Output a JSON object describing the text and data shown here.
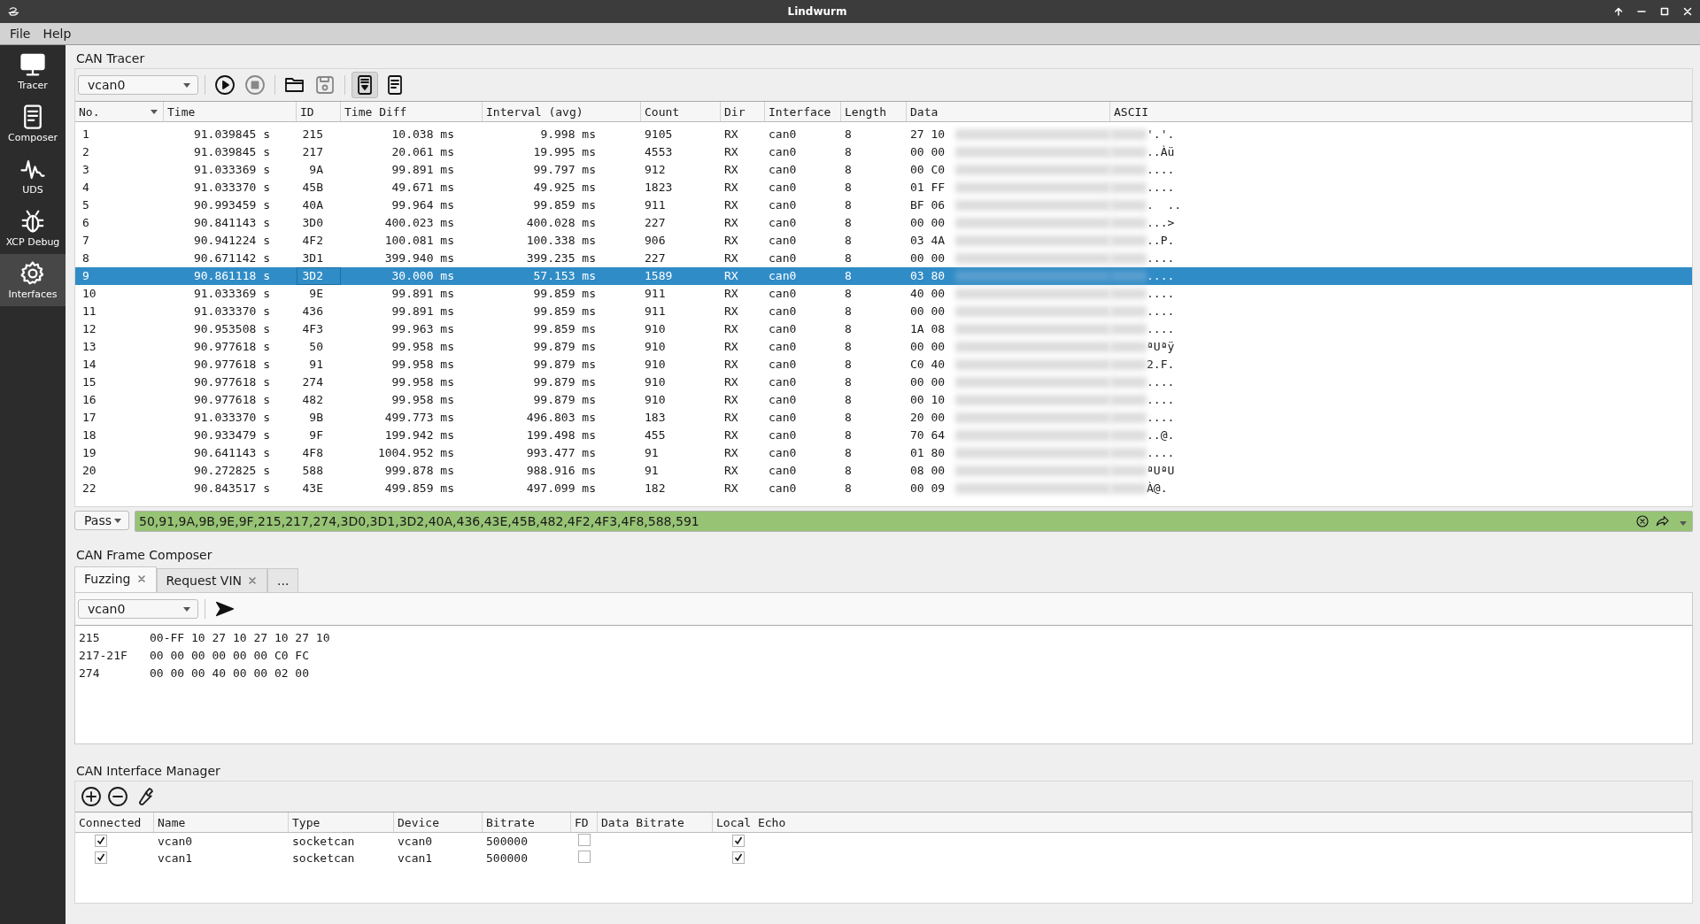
{
  "window": {
    "title": "Lindwurm"
  },
  "menu": [
    "File",
    "Help"
  ],
  "sidebar": {
    "items": [
      {
        "label": "Tracer",
        "kind": "monitor",
        "selected": false
      },
      {
        "label": "Composer",
        "kind": "document",
        "selected": false
      },
      {
        "label": "UDS",
        "kind": "wave",
        "selected": false
      },
      {
        "label": "XCP Debug",
        "kind": "bug",
        "selected": false
      },
      {
        "label": "Interfaces",
        "kind": "gear",
        "selected": true
      }
    ]
  },
  "tracer": {
    "title": "CAN Tracer",
    "interface": "vcan0",
    "toolbar": [
      {
        "kind": "play",
        "disabled": false,
        "pressed": false
      },
      {
        "kind": "stop",
        "disabled": true,
        "pressed": false
      },
      {
        "kind": "open",
        "disabled": false,
        "pressed": false
      },
      {
        "kind": "save",
        "disabled": true,
        "pressed": false
      },
      {
        "kind": "autoscroll",
        "disabled": false,
        "pressed": true
      },
      {
        "kind": "log",
        "disabled": false,
        "pressed": false
      }
    ],
    "columns": [
      {
        "label": "No.",
        "sorted": true
      },
      {
        "label": "Time",
        "sorted": false
      },
      {
        "label": "ID",
        "sorted": false
      },
      {
        "label": "Time Diff",
        "sorted": false
      },
      {
        "label": "Interval (avg)",
        "sorted": false
      },
      {
        "label": "Count",
        "sorted": false
      },
      {
        "label": "Dir",
        "sorted": false
      },
      {
        "label": "Interface",
        "sorted": false
      },
      {
        "label": "Length",
        "sorted": false
      },
      {
        "label": "Data",
        "sorted": false
      },
      {
        "label": "ASCII",
        "sorted": false
      }
    ],
    "rows": [
      {
        "selected": false,
        "cells": [
          "1",
          "91.039845 s",
          "215",
          "10.038 ms",
          "9.998 ms",
          "9105",
          "RX",
          "can0",
          "8",
          "27 10",
          "'.'."
        ]
      },
      {
        "selected": false,
        "cells": [
          "2",
          "91.039845 s",
          "217",
          "20.061 ms",
          "19.995 ms",
          "4553",
          "RX",
          "can0",
          "8",
          "00 00",
          "..Àü"
        ]
      },
      {
        "selected": false,
        "cells": [
          "3",
          "91.033369 s",
          "9A",
          "99.891 ms",
          "99.797 ms",
          "912",
          "RX",
          "can0",
          "8",
          "00 C0",
          "...."
        ]
      },
      {
        "selected": false,
        "cells": [
          "4",
          "91.033370 s",
          "45B",
          "49.671 ms",
          "49.925 ms",
          "1823",
          "RX",
          "can0",
          "8",
          "01 FF",
          "...."
        ]
      },
      {
        "selected": false,
        "cells": [
          "5",
          "90.993459 s",
          "40A",
          "99.964 ms",
          "99.859 ms",
          "911",
          "RX",
          "can0",
          "8",
          "BF 06",
          ".  .."
        ]
      },
      {
        "selected": false,
        "cells": [
          "6",
          "90.841143 s",
          "3D0",
          "400.023 ms",
          "400.028 ms",
          "227",
          "RX",
          "can0",
          "8",
          "00 00",
          "...>"
        ]
      },
      {
        "selected": false,
        "cells": [
          "7",
          "90.941224 s",
          "4F2",
          "100.081 ms",
          "100.338 ms",
          "906",
          "RX",
          "can0",
          "8",
          "03 4A",
          "..P."
        ]
      },
      {
        "selected": false,
        "cells": [
          "8",
          "90.671142 s",
          "3D1",
          "399.940 ms",
          "399.235 ms",
          "227",
          "RX",
          "can0",
          "8",
          "00 00",
          "...."
        ]
      },
      {
        "selected": true,
        "cells": [
          "9",
          "90.861118 s",
          "3D2",
          "30.000 ms",
          "57.153 ms",
          "1589",
          "RX",
          "can0",
          "8",
          "03 80",
          "...."
        ]
      },
      {
        "selected": false,
        "cells": [
          "10",
          "91.033369 s",
          "9E",
          "99.891 ms",
          "99.859 ms",
          "911",
          "RX",
          "can0",
          "8",
          "40 00",
          "...."
        ]
      },
      {
        "selected": false,
        "cells": [
          "11",
          "91.033370 s",
          "436",
          "99.891 ms",
          "99.859 ms",
          "911",
          "RX",
          "can0",
          "8",
          "00 00",
          "...."
        ]
      },
      {
        "selected": false,
        "cells": [
          "12",
          "90.953508 s",
          "4F3",
          "99.963 ms",
          "99.859 ms",
          "910",
          "RX",
          "can0",
          "8",
          "1A 08",
          "...."
        ]
      },
      {
        "selected": false,
        "cells": [
          "13",
          "90.977618 s",
          "50",
          "99.958 ms",
          "99.879 ms",
          "910",
          "RX",
          "can0",
          "8",
          "00 00",
          "ªUªÿ"
        ]
      },
      {
        "selected": false,
        "cells": [
          "14",
          "90.977618 s",
          "91",
          "99.958 ms",
          "99.879 ms",
          "910",
          "RX",
          "can0",
          "8",
          "C0 40",
          "2.F."
        ]
      },
      {
        "selected": false,
        "cells": [
          "15",
          "90.977618 s",
          "274",
          "99.958 ms",
          "99.879 ms",
          "910",
          "RX",
          "can0",
          "8",
          "00 00",
          "...."
        ]
      },
      {
        "selected": false,
        "cells": [
          "16",
          "90.977618 s",
          "482",
          "99.958 ms",
          "99.879 ms",
          "910",
          "RX",
          "can0",
          "8",
          "00 10",
          "...."
        ]
      },
      {
        "selected": false,
        "cells": [
          "17",
          "91.033370 s",
          "9B",
          "499.773 ms",
          "496.803 ms",
          "183",
          "RX",
          "can0",
          "8",
          "20 00",
          "...."
        ]
      },
      {
        "selected": false,
        "cells": [
          "18",
          "90.933479 s",
          "9F",
          "199.942 ms",
          "199.498 ms",
          "455",
          "RX",
          "can0",
          "8",
          "70 64",
          "..@."
        ]
      },
      {
        "selected": false,
        "cells": [
          "19",
          "90.641143 s",
          "4F8",
          "1004.952 ms",
          "993.477 ms",
          "91",
          "RX",
          "can0",
          "8",
          "01 80",
          "...."
        ]
      },
      {
        "selected": false,
        "cells": [
          "20",
          "90.272825 s",
          "588",
          "999.878 ms",
          "988.916 ms",
          "91",
          "RX",
          "can0",
          "8",
          "08 00",
          "ªUªU"
        ]
      },
      {
        "selected": false,
        "cells": [
          "22",
          "90.843517 s",
          "43E",
          "499.859 ms",
          "497.099 ms",
          "182",
          "RX",
          "can0",
          "8",
          "00 09",
          "À@."
        ]
      }
    ],
    "filter": {
      "mode": "Pass",
      "value": "50,91,9A,9B,9E,9F,215,217,274,3D0,3D1,3D2,40A,436,43E,45B,482,4F2,4F3,4F8,588,591"
    }
  },
  "composer": {
    "title": "CAN Frame Composer",
    "tabs": [
      {
        "label": "Fuzzing",
        "selected": true,
        "closable": true
      },
      {
        "label": "Request VIN",
        "selected": false,
        "closable": true
      },
      {
        "label": "...",
        "selected": false,
        "closable": false
      }
    ],
    "interface": "vcan0",
    "lines": [
      {
        "id": "215",
        "data": "00-FF 10 27 10 27 10 27 10"
      },
      {
        "id": "217-21F",
        "data": "00 00 00 00 00 00 C0 FC"
      },
      {
        "id": "274",
        "data": "00 00 00 40 00 00 02 00"
      }
    ]
  },
  "manager": {
    "title": "CAN Interface Manager",
    "columns": [
      "Connected",
      "Name",
      "Type",
      "Device",
      "Bitrate",
      "FD",
      "Data Bitrate",
      "Local Echo"
    ],
    "rows": [
      {
        "connected": true,
        "name": "vcan0",
        "type": "socketcan",
        "device": "vcan0",
        "bitrate": "500000",
        "fd": false,
        "local_echo": true
      },
      {
        "connected": true,
        "name": "vcan1",
        "type": "socketcan",
        "device": "vcan1",
        "bitrate": "500000",
        "fd": false,
        "local_echo": true
      }
    ]
  }
}
